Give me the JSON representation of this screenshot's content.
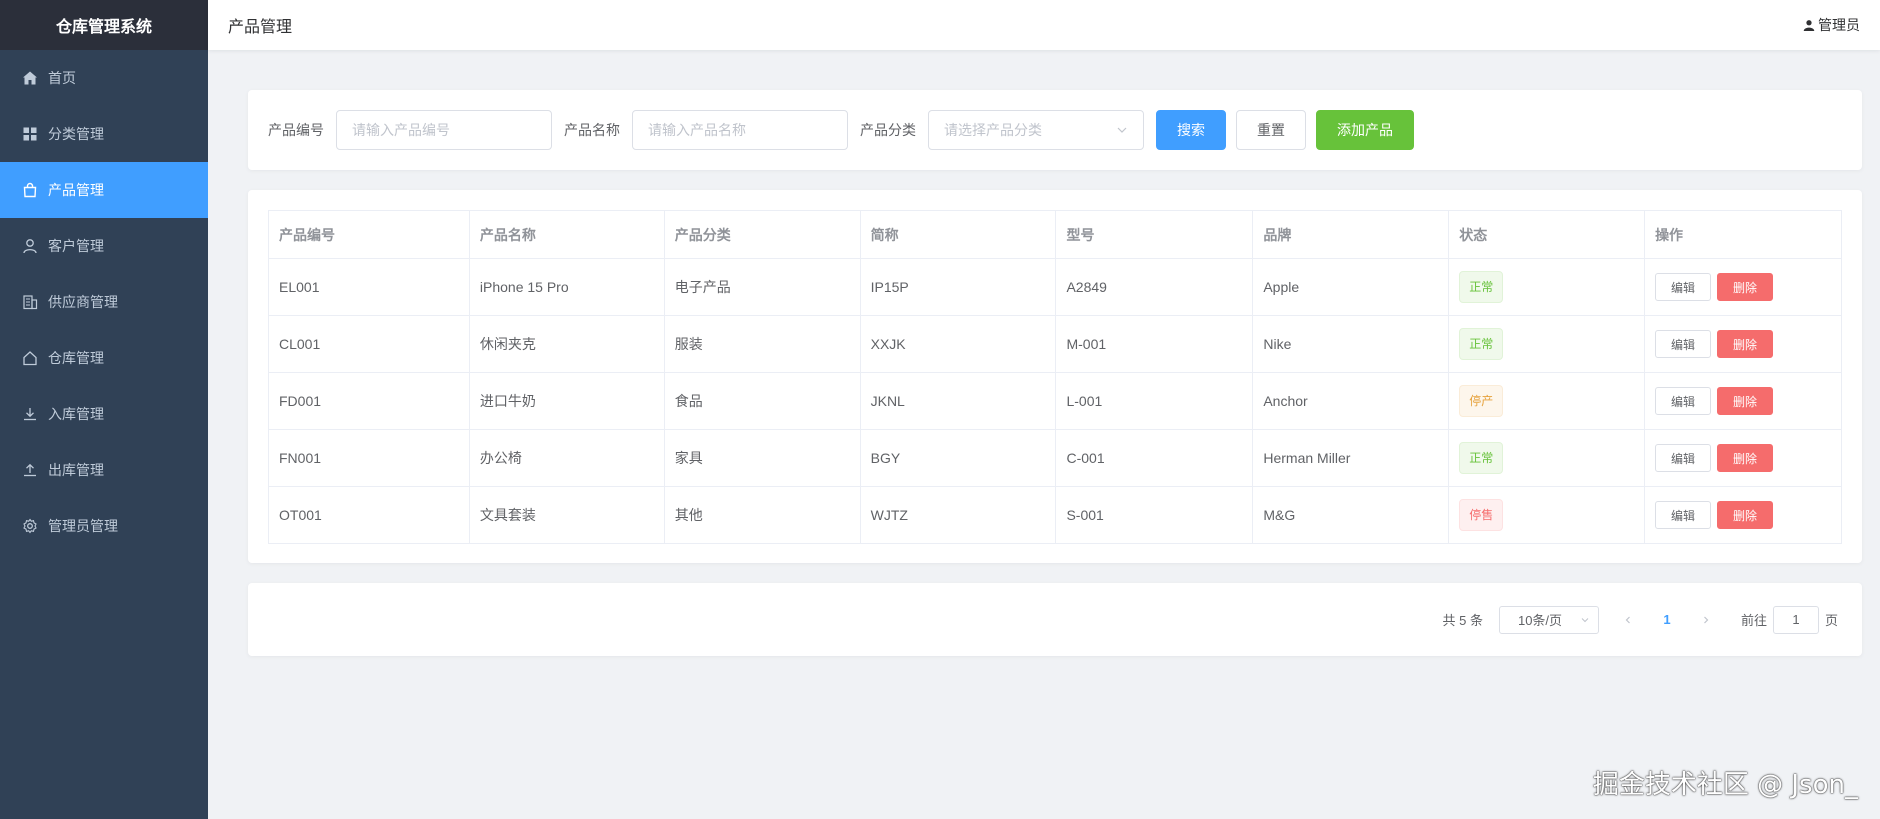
{
  "sidebar": {
    "title": "仓库管理系统",
    "items": [
      {
        "label": "首页",
        "icon": "home-icon"
      },
      {
        "label": "分类管理",
        "icon": "grid-icon"
      },
      {
        "label": "产品管理",
        "icon": "shopping-bag-icon",
        "active": true
      },
      {
        "label": "客户管理",
        "icon": "user-icon"
      },
      {
        "label": "供应商管理",
        "icon": "office-building-icon"
      },
      {
        "label": "仓库管理",
        "icon": "house-icon"
      },
      {
        "label": "入库管理",
        "icon": "download-icon"
      },
      {
        "label": "出库管理",
        "icon": "upload-icon"
      },
      {
        "label": "管理员管理",
        "icon": "setting-icon"
      }
    ]
  },
  "header": {
    "title": "产品管理",
    "user": "管理员"
  },
  "search": {
    "code_label": "产品编号",
    "code_placeholder": "请输入产品编号",
    "name_label": "产品名称",
    "name_placeholder": "请输入产品名称",
    "category_label": "产品分类",
    "category_placeholder": "请选择产品分类",
    "search_btn": "搜索",
    "reset_btn": "重置",
    "add_btn": "添加产品"
  },
  "table": {
    "headers": [
      "产品编号",
      "产品名称",
      "产品分类",
      "简称",
      "型号",
      "品牌",
      "状态",
      "操作"
    ],
    "rows": [
      {
        "code": "EL001",
        "name": "iPhone 15 Pro",
        "category": "电子产品",
        "abbr": "IP15P",
        "model": "A2849",
        "brand": "Apple",
        "status": "正常",
        "status_type": "success"
      },
      {
        "code": "CL001",
        "name": "休闲夹克",
        "category": "服装",
        "abbr": "XXJK",
        "model": "M-001",
        "brand": "Nike",
        "status": "正常",
        "status_type": "success"
      },
      {
        "code": "FD001",
        "name": "进口牛奶",
        "category": "食品",
        "abbr": "JKNL",
        "model": "L-001",
        "brand": "Anchor",
        "status": "停产",
        "status_type": "warning"
      },
      {
        "code": "FN001",
        "name": "办公椅",
        "category": "家具",
        "abbr": "BGY",
        "model": "C-001",
        "brand": "Herman Miller",
        "status": "正常",
        "status_type": "success"
      },
      {
        "code": "OT001",
        "name": "文具套装",
        "category": "其他",
        "abbr": "WJTZ",
        "model": "S-001",
        "brand": "M&G",
        "status": "停售",
        "status_type": "danger"
      }
    ],
    "edit_label": "编辑",
    "delete_label": "删除"
  },
  "pagination": {
    "total": "共 5 条",
    "page_size": "10条/页",
    "current_page": "1",
    "goto_label": "前往",
    "goto_value": "1",
    "page_suffix": "页"
  },
  "watermark": "掘金技术社区 @ Json_",
  "colors": {
    "sidebar_bg": "#304156",
    "active": "#409eff",
    "success": "#67c23a",
    "danger": "#f56c6c",
    "warning": "#e6a23c"
  }
}
